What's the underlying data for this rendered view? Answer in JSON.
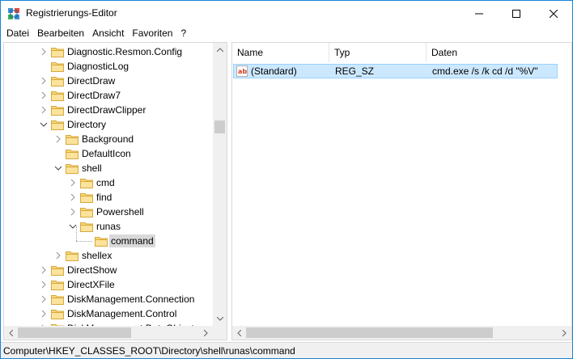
{
  "window": {
    "title": "Registrierungs-Editor"
  },
  "menu": [
    "Datei",
    "Bearbeiten",
    "Ansicht",
    "Favoriten",
    "?"
  ],
  "tree": {
    "items": [
      {
        "label": "Diagnostic.Resmon.Config",
        "level": 0,
        "expander": "collapsed"
      },
      {
        "label": "DiagnosticLog",
        "level": 0,
        "expander": "none"
      },
      {
        "label": "DirectDraw",
        "level": 0,
        "expander": "collapsed"
      },
      {
        "label": "DirectDraw7",
        "level": 0,
        "expander": "collapsed"
      },
      {
        "label": "DirectDrawClipper",
        "level": 0,
        "expander": "collapsed"
      },
      {
        "label": "Directory",
        "level": 0,
        "expander": "expanded"
      },
      {
        "label": "Background",
        "level": 1,
        "expander": "collapsed"
      },
      {
        "label": "DefaultIcon",
        "level": 1,
        "expander": "none"
      },
      {
        "label": "shell",
        "level": 1,
        "expander": "expanded"
      },
      {
        "label": "cmd",
        "level": 2,
        "expander": "collapsed"
      },
      {
        "label": "find",
        "level": 2,
        "expander": "collapsed"
      },
      {
        "label": "Powershell",
        "level": 2,
        "expander": "collapsed"
      },
      {
        "label": "runas",
        "level": 2,
        "expander": "expanded"
      },
      {
        "label": "command",
        "level": 3,
        "expander": "none",
        "selected": true
      },
      {
        "label": "shellex",
        "level": 1,
        "expander": "collapsed"
      },
      {
        "label": "DirectShow",
        "level": 0,
        "expander": "collapsed"
      },
      {
        "label": "DirectXFile",
        "level": 0,
        "expander": "collapsed"
      },
      {
        "label": "DiskManagement.Connection",
        "level": 0,
        "expander": "collapsed"
      },
      {
        "label": "DiskManagement.Control",
        "level": 0,
        "expander": "collapsed"
      },
      {
        "label": "DiskManagement.DataObject",
        "level": 0,
        "expander": "collapsed"
      }
    ]
  },
  "list": {
    "columns": [
      "Name",
      "Typ",
      "Daten"
    ],
    "rows": [
      {
        "name": "(Standard)",
        "type": "REG_SZ",
        "data": "cmd.exe /s /k cd /d \"%V\"",
        "icon": "string-value-icon"
      }
    ]
  },
  "status": {
    "path": "Computer\\HKEY_CLASSES_ROOT\\Directory\\shell\\runas\\command"
  },
  "colors": {
    "accent_border": "#1883d7",
    "selection": "#cce8ff",
    "folder": "#f8d775"
  }
}
